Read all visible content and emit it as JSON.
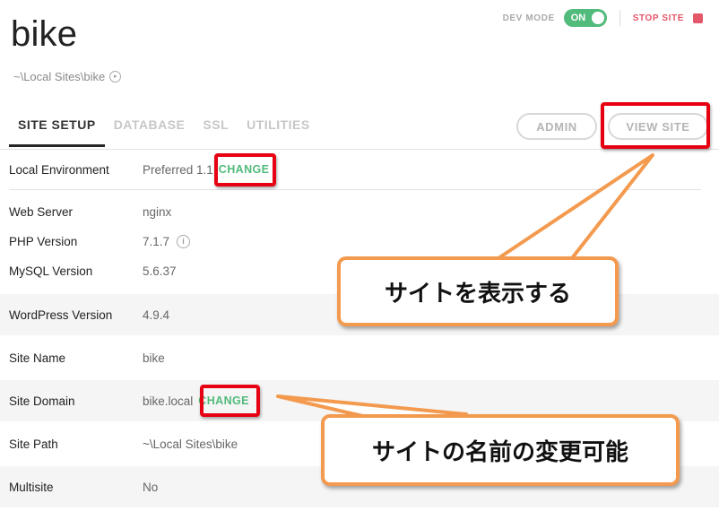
{
  "site": {
    "name": "bike",
    "path": "~\\Local Sites\\bike"
  },
  "topbar": {
    "dev_mode_label": "DEV MODE",
    "dev_mode_state": "ON",
    "stop_site_label": "STOP SITE"
  },
  "tabs": [
    {
      "label": "SITE SETUP",
      "active": true
    },
    {
      "label": "DATABASE",
      "active": false
    },
    {
      "label": "SSL",
      "active": false
    },
    {
      "label": "UTILITIES",
      "active": false
    }
  ],
  "buttons": {
    "admin": "ADMIN",
    "view_site": "VIEW SITE"
  },
  "rows": [
    {
      "label": "Local Environment",
      "value": "Preferred 1.1",
      "action": "CHANGE"
    },
    {
      "label": "Web Server",
      "value": "nginx"
    },
    {
      "label": "PHP Version",
      "value": "7.1.7"
    },
    {
      "label": "MySQL Version",
      "value": "5.6.37"
    },
    {
      "label": "WordPress Version",
      "value": "4.9.4"
    },
    {
      "label": "Site Name",
      "value": "bike"
    },
    {
      "label": "Site Domain",
      "value": "bike.local",
      "action": "CHANGE"
    },
    {
      "label": "Site Path",
      "value": "~\\Local Sites\\bike"
    },
    {
      "label": "Multisite",
      "value": "No"
    }
  ],
  "annotations": {
    "view_site_callout": "サイトを表示する",
    "site_name_callout": "サイトの名前の変更可能"
  },
  "colors": {
    "accent_green": "#51bb7b",
    "stop_red": "#e4566a",
    "highlight_red": "#e60012",
    "callout_orange": "#f39a4f"
  }
}
